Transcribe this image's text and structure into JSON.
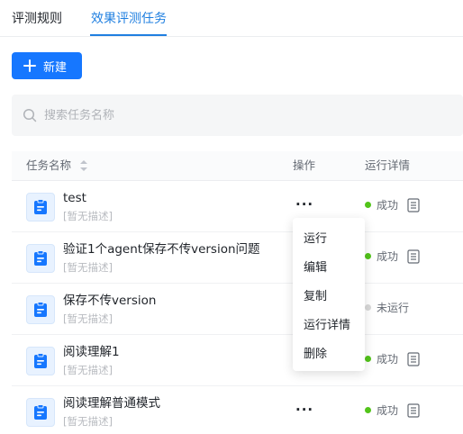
{
  "tabs": [
    {
      "label": "评测规则",
      "active": false
    },
    {
      "label": "效果评测任务",
      "active": true
    }
  ],
  "toolbar": {
    "new_label": "新建"
  },
  "search": {
    "placeholder": "搜索任务名称"
  },
  "table": {
    "columns": [
      "任务名称",
      "操作",
      "运行详情"
    ],
    "rows": [
      {
        "name": "test",
        "desc": "[暂无描述]",
        "status": "成功"
      },
      {
        "name": "验证1个agent保存不传version问题",
        "desc": "[暂无描述]",
        "status": "成功"
      },
      {
        "name": "保存不传version",
        "desc": "[暂无描述]",
        "status": "未运行"
      },
      {
        "name": "阅读理解1",
        "desc": "[暂无描述]",
        "status": "成功"
      },
      {
        "name": "阅读理解普通模式",
        "desc": "[暂无描述]",
        "status": "成功"
      }
    ],
    "more_label": "···"
  },
  "menu": {
    "items": [
      "运行",
      "编辑",
      "复制",
      "运行详情",
      "删除"
    ]
  },
  "colors": {
    "accent": "#1677ff",
    "tab_active": "#1f7fe0",
    "success": "#52c41a",
    "idle": "#d9d9d9"
  },
  "icons": {
    "new": "plus-icon",
    "search": "search-icon",
    "row": "task-file-icon",
    "detail": "document-icon",
    "sort": "sort-icon"
  }
}
